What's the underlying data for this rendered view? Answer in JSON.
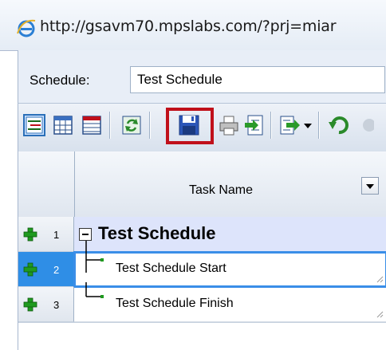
{
  "browser": {
    "url": "http://gsavm70.mpslabs.com/?prj=miar"
  },
  "schedule_bar": {
    "label": "Schedule:",
    "value": "Test Schedule"
  },
  "toolbar": {
    "buttons": [
      "outline-view-icon",
      "grid-view-icon",
      "calendar-view-icon",
      "refresh-icon",
      "save-icon",
      "print-icon",
      "import-icon",
      "export-dropdown-icon",
      "undo-icon"
    ],
    "highlighted": "save-icon"
  },
  "grid": {
    "header_task_name": "Task Name",
    "rows": [
      {
        "num": "1",
        "name": "Test Schedule"
      },
      {
        "num": "2",
        "name": "Test Schedule Start"
      },
      {
        "num": "3",
        "name": "Test Schedule Finish"
      }
    ]
  },
  "colors": {
    "highlight": "#c0101a",
    "selected_row": "#2f8ee6",
    "summary_row": "#dde4fb",
    "add_icon": "#1f9a1f"
  }
}
